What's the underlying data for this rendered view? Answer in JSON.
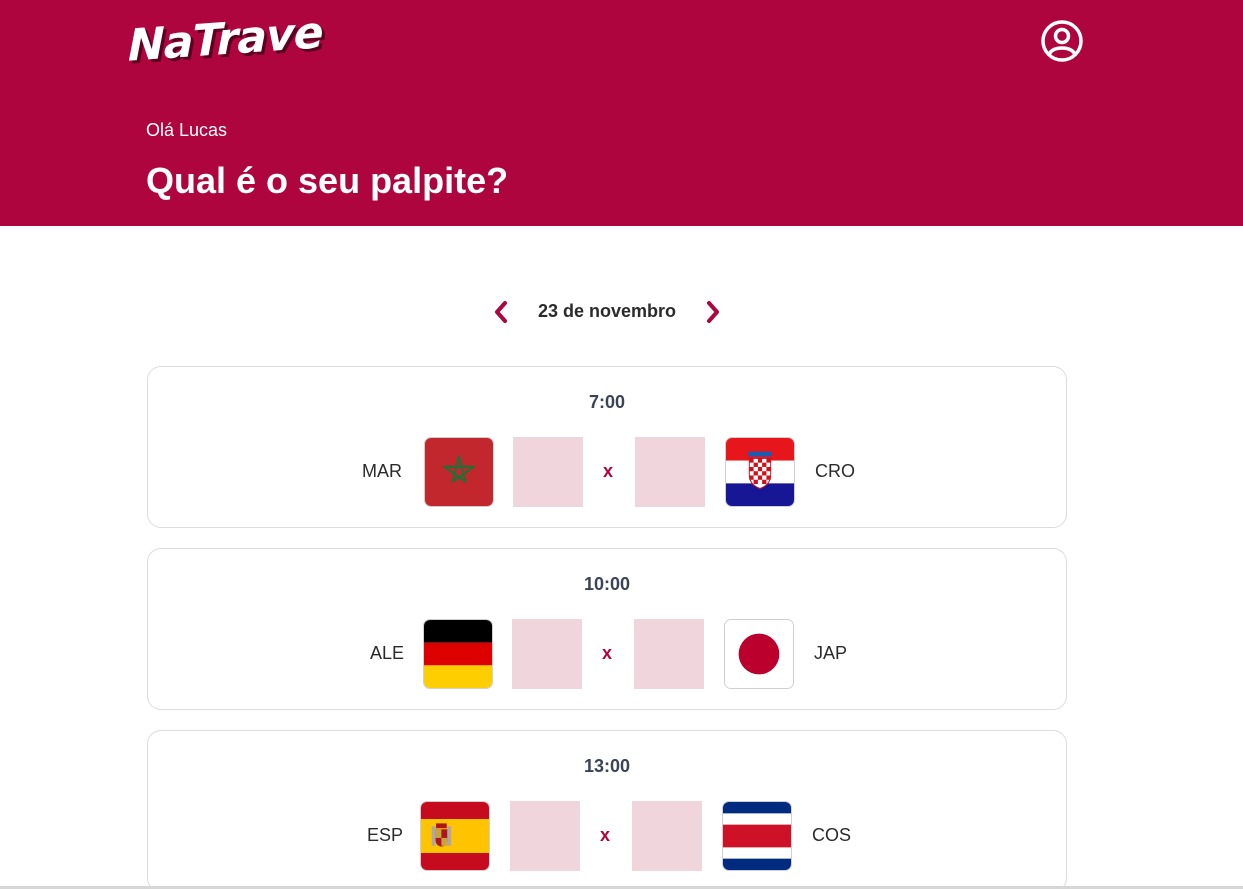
{
  "app": {
    "logo_text": "NaTrave",
    "brand_color": "#af053f",
    "profile_icon": "user-circle-icon"
  },
  "hero": {
    "greeting": "Olá Lucas",
    "headline": "Qual é o seu palpite?"
  },
  "date_nav": {
    "label": "23 de novembro",
    "prev_icon": "chevron-left-icon",
    "next_icon": "chevron-right-icon"
  },
  "games": [
    {
      "time": "7:00",
      "home": {
        "code": "MAR",
        "flag": "morocco-flag-icon"
      },
      "home_score": "",
      "separator": "x",
      "away_score": "",
      "away": {
        "code": "CRO",
        "flag": "croatia-flag-icon"
      }
    },
    {
      "time": "10:00",
      "home": {
        "code": "ALE",
        "flag": "germany-flag-icon"
      },
      "home_score": "",
      "separator": "x",
      "away_score": "",
      "away": {
        "code": "JAP",
        "flag": "japan-flag-icon"
      }
    },
    {
      "time": "13:00",
      "home": {
        "code": "ESP",
        "flag": "spain-flag-icon"
      },
      "home_score": "",
      "separator": "x",
      "away_score": "",
      "away": {
        "code": "COS",
        "flag": "costa-rica-flag-icon"
      }
    }
  ]
}
